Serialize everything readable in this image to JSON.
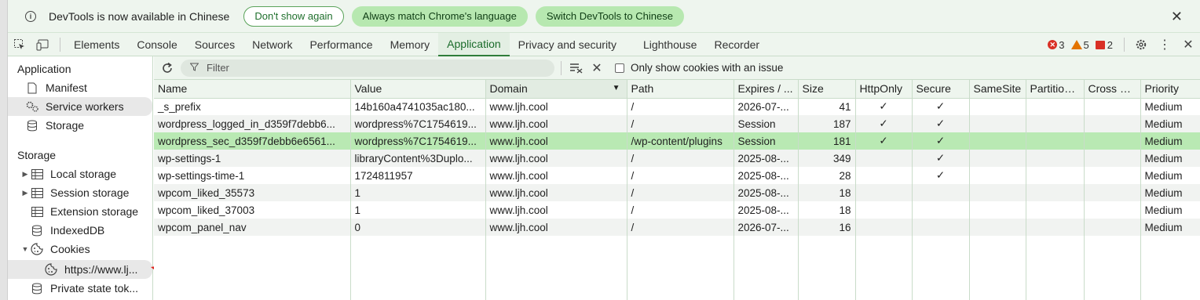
{
  "infobar": {
    "message": "DevTools is now available in Chinese",
    "btn_dont_show": "Don't show again",
    "btn_match": "Always match Chrome's language",
    "btn_switch": "Switch DevTools to Chinese",
    "close": "✕"
  },
  "tabs": [
    "Elements",
    "Console",
    "Sources",
    "Network",
    "Performance",
    "Memory",
    "Application",
    "Privacy and security",
    "Lighthouse",
    "Recorder"
  ],
  "active_tab": "Application",
  "badges": {
    "errors": "3",
    "warnings": "5",
    "issues": "2"
  },
  "sidebar": {
    "application_header": "Application",
    "app_items": [
      "Manifest",
      "Service workers",
      "Storage"
    ],
    "storage_header": "Storage",
    "storage_items": [
      "Local storage",
      "Session storage",
      "Extension storage",
      "IndexedDB",
      "Cookies",
      "https://www.lj...",
      "Private state tok..."
    ]
  },
  "toolbar": {
    "filter_placeholder": "Filter",
    "only_issue_label": "Only show cookies with an issue"
  },
  "table": {
    "columns": [
      "Name",
      "Value",
      "Domain",
      "Path",
      "Expires / ...",
      "Size",
      "HttpOnly",
      "Secure",
      "SameSite",
      "Partition...",
      "Cross Si...",
      "Priority"
    ],
    "rows": [
      [
        "_s_prefix",
        "14b160a4741035ac180...",
        "www.ljh.cool",
        "/",
        "2026-07-...",
        "41",
        "✓",
        "✓",
        "",
        "",
        "",
        "Medium"
      ],
      [
        "wordpress_logged_in_d359f7debb6...",
        "wordpress%7C1754619...",
        "www.ljh.cool",
        "/",
        "Session",
        "187",
        "✓",
        "✓",
        "",
        "",
        "",
        "Medium"
      ],
      [
        "wordpress_sec_d359f7debb6e6561...",
        "wordpress%7C1754619...",
        "www.ljh.cool",
        "/wp-content/plugins",
        "Session",
        "181",
        "✓",
        "✓",
        "",
        "",
        "",
        "Medium"
      ],
      [
        "wp-settings-1",
        "libraryContent%3Duplo...",
        "www.ljh.cool",
        "/",
        "2025-08-...",
        "349",
        "",
        "✓",
        "",
        "",
        "",
        "Medium"
      ],
      [
        "wp-settings-time-1",
        "1724811957",
        "www.ljh.cool",
        "/",
        "2025-08-...",
        "28",
        "",
        "✓",
        "",
        "",
        "",
        "Medium"
      ],
      [
        "wpcom_liked_35573",
        "1",
        "www.ljh.cool",
        "/",
        "2025-08-...",
        "18",
        "",
        "",
        "",
        "",
        "",
        "Medium"
      ],
      [
        "wpcom_liked_37003",
        "1",
        "www.ljh.cool",
        "/",
        "2025-08-...",
        "18",
        "",
        "",
        "",
        "",
        "",
        "Medium"
      ],
      [
        "wpcom_panel_nav",
        "0",
        "www.ljh.cool",
        "/",
        "2026-07-...",
        "16",
        "",
        "",
        "",
        "",
        "",
        "Medium"
      ]
    ],
    "selected_row": 2
  },
  "colors": {
    "accent": "#1a6b2a",
    "selected_row": "#b9e9b3",
    "arrow": "#e0201c"
  }
}
